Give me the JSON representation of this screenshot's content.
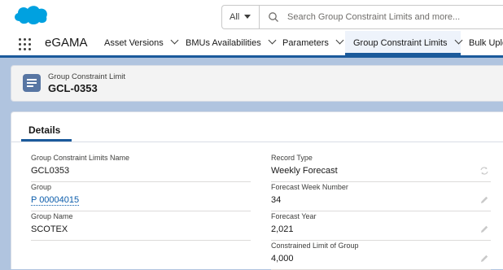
{
  "top_bar": {
    "search_scope": "All",
    "search_placeholder": "Search Group Constraint Limits and more..."
  },
  "nav": {
    "app_name": "eGAMA",
    "items": [
      {
        "label": "Asset Versions",
        "active": false
      },
      {
        "label": "BMUs Availabilities",
        "active": false
      },
      {
        "label": "Parameters",
        "active": false
      },
      {
        "label": "Group Constraint Limits",
        "active": true
      },
      {
        "label": "Bulk Uplo",
        "active": false
      }
    ]
  },
  "record_header": {
    "object_label": "Group Constraint Limit",
    "title": "GCL-0353"
  },
  "details": {
    "tab_label": "Details",
    "left_fields": [
      {
        "label": "Group Constraint Limits Name",
        "value": "GCL0353"
      },
      {
        "label": "Group",
        "value": "P 00004015"
      },
      {
        "label": "Group Name",
        "value": "SCOTEX"
      }
    ],
    "right_fields": [
      {
        "label": "Record Type",
        "value": "Weekly Forecast"
      },
      {
        "label": "Forecast Week Number",
        "value": "34"
      },
      {
        "label": "Forecast Year",
        "value": "2,021"
      },
      {
        "label": "Constrained Limit of Group",
        "value": "4,000"
      }
    ]
  },
  "colors": {
    "brand_blue": "#1b5a9b",
    "logo_blue": "#00a1e0",
    "link_blue": "#0b5cab",
    "background": "#b0c4df"
  }
}
